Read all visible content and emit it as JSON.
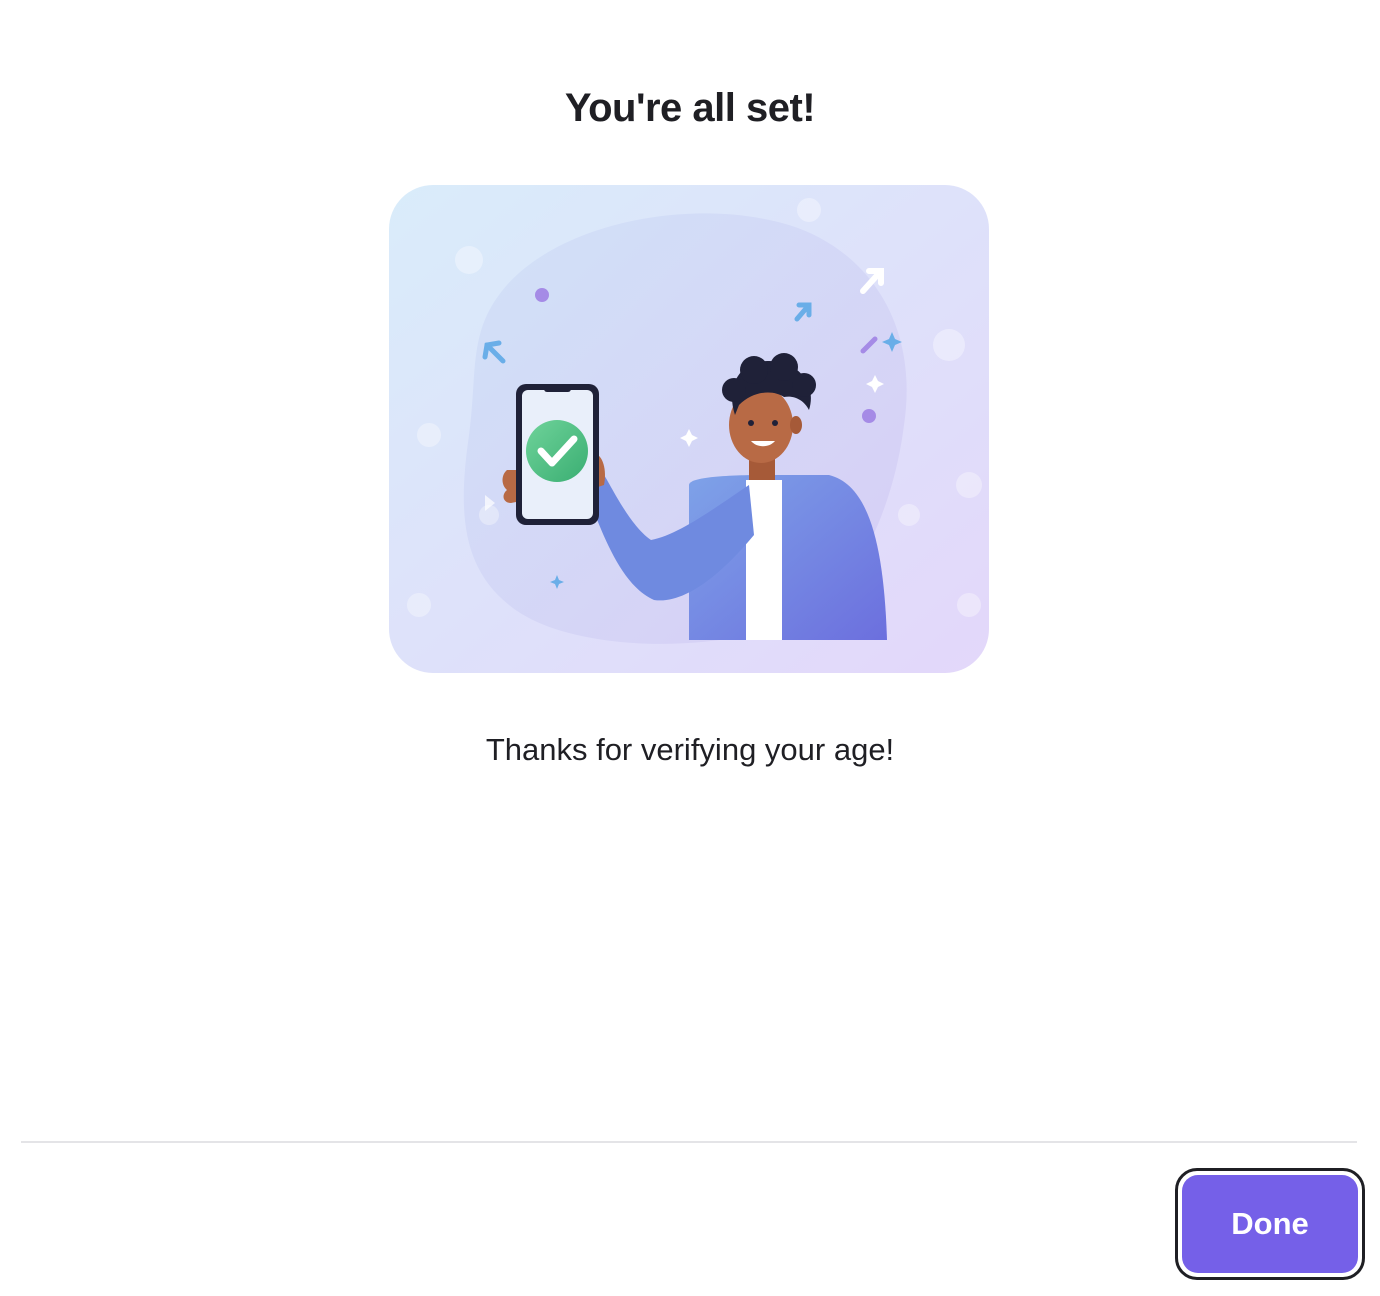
{
  "dialog": {
    "title": "You're all set!",
    "message": "Thanks for verifying your age!",
    "illustration": "person-holding-phone-with-checkmark-illustration"
  },
  "footer": {
    "done_label": "Done"
  },
  "colors": {
    "accent": "#7560e8",
    "text": "#1f1f24",
    "success": "#4cbf7f",
    "jacket": "#6f8ae0"
  }
}
